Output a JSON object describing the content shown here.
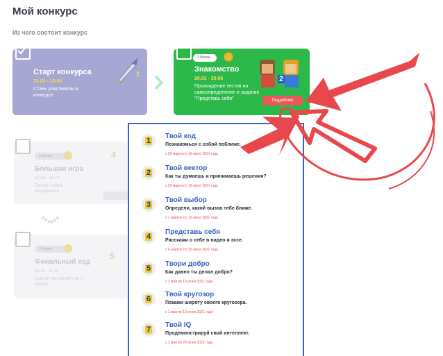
{
  "page": {
    "title": "Мой конкурс",
    "subtitle": "Из чего состоит конкурс"
  },
  "cards": [
    {
      "title": "Старт конкурса",
      "dates": "20.03 - 15.06",
      "desc": "Стань участником в конкурсе",
      "num": "1"
    },
    {
      "badge": "3 балла",
      "title": "Знакомство",
      "dates": "20.03 - 30.06",
      "desc": "Прохождение тестов на самоопределение и задание \"Представь себя\"",
      "button": "Подробнее",
      "num": "2"
    }
  ],
  "ghost_cards": [
    {
      "badge": "3 балла",
      "title": "Большая игра",
      "dates": "27.08 - 08.10",
      "desc": "Прояви себя в полуфинале",
      "num": "4"
    },
    {
      "badge": "3 балла",
      "title": "Финальный ход",
      "dates": "03.11 - 27.11",
      "desc": "Сделай последний шаг к победе",
      "num": "5"
    }
  ],
  "tasks": [
    {
      "num": "1",
      "title": "Твой код",
      "desc": "Познакомься с собой поближе.",
      "dates": "с 20 марта по 10 июня 2021 года"
    },
    {
      "num": "2",
      "title": "Твой вектор",
      "desc": "Как ты думаешь и принимаешь решения?",
      "dates": "с 20 марта по 10 июня 2021 года"
    },
    {
      "num": "3",
      "title": "Твой выбор",
      "desc": "Определи, какой вызов тебе ближе.",
      "dates": "с 1 апреля по 10 июня 2021 года"
    },
    {
      "num": "4",
      "title": "Представь себя",
      "desc": "Расскажи о себе в видео и эссе.",
      "dates": "с 4 апреля по 30 июня 2021 года"
    },
    {
      "num": "5",
      "title": "Твори добро",
      "desc": "Как давно ты делал добро?",
      "dates": "с 1 мая по 10 июня 2021 года"
    },
    {
      "num": "6",
      "title": "Твой кругозор",
      "desc": "Покажи широту своего кругозора.",
      "dates": "с 1 мая по 10 июня 2021 года"
    },
    {
      "num": "7",
      "title": "Твой IQ",
      "desc": "Продемонстрируй свой интеллект.",
      "dates": "с 1 мая по 20 июня 2021 года"
    }
  ],
  "colors": {
    "card1": "#a7a7d3",
    "card2": "#2cb84a",
    "accent": "#3e5fbe",
    "annotation": "#e8474b",
    "button": "#e85a56"
  },
  "icons": {
    "card1": "rocket-icon",
    "card2": "characters-icon",
    "coin": "coin-icon",
    "chevron": "chevron-right-icon"
  }
}
